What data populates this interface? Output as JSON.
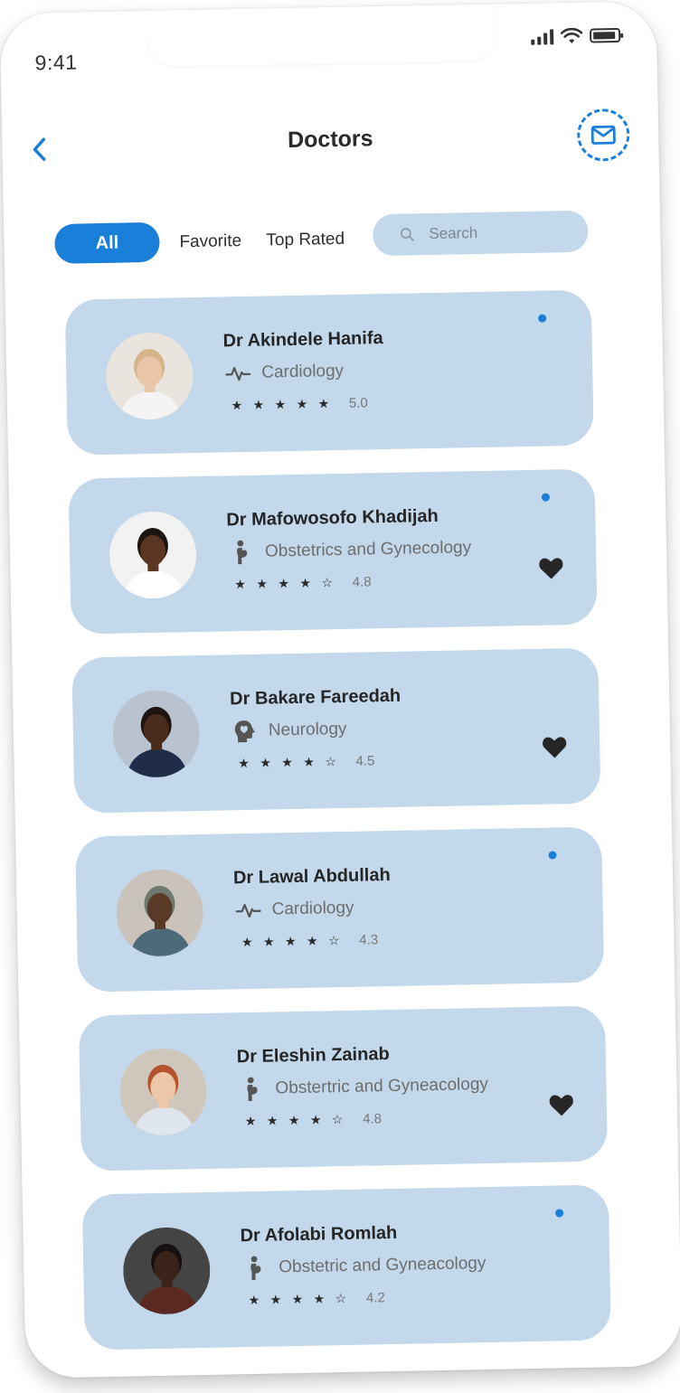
{
  "status": {
    "time": "9:41"
  },
  "header": {
    "title": "Doctors"
  },
  "filters": {
    "all": "All",
    "favorite": "Favorite",
    "top_rated": "Top Rated",
    "search_placeholder": "Search"
  },
  "colors": {
    "accent": "#1a7fd8",
    "card": "#c3d8ea"
  },
  "doctors": [
    {
      "name": "Dr Akindele Hanifa",
      "specialty": "Cardiology",
      "specialty_icon": "heartbeat-icon",
      "rating": "5.0",
      "stars": 5,
      "online": true,
      "favorite": false
    },
    {
      "name": "Dr Mafowosofo Khadijah",
      "specialty": "Obstetrics and Gynecology",
      "specialty_icon": "pregnant-icon",
      "rating": "4.8",
      "stars": 4,
      "online": true,
      "favorite": true
    },
    {
      "name": "Dr Bakare Fareedah",
      "specialty": "Neurology",
      "specialty_icon": "brain-head-icon",
      "rating": "4.5",
      "stars": 4,
      "online": false,
      "favorite": true
    },
    {
      "name": "Dr Lawal Abdullah",
      "specialty": "Cardiology",
      "specialty_icon": "heartbeat-icon",
      "rating": "4.3",
      "stars": 4,
      "online": true,
      "favorite": false
    },
    {
      "name": "Dr Eleshin Zainab",
      "specialty": "Obstertric and Gyneacology",
      "specialty_icon": "pregnant-icon",
      "rating": "4.8",
      "stars": 4,
      "online": false,
      "favorite": true
    },
    {
      "name": "Dr Afolabi Romlah",
      "specialty": "Obstetric and Gyneacology",
      "specialty_icon": "pregnant-icon",
      "rating": "4.2",
      "stars": 4,
      "online": true,
      "favorite": false
    }
  ]
}
